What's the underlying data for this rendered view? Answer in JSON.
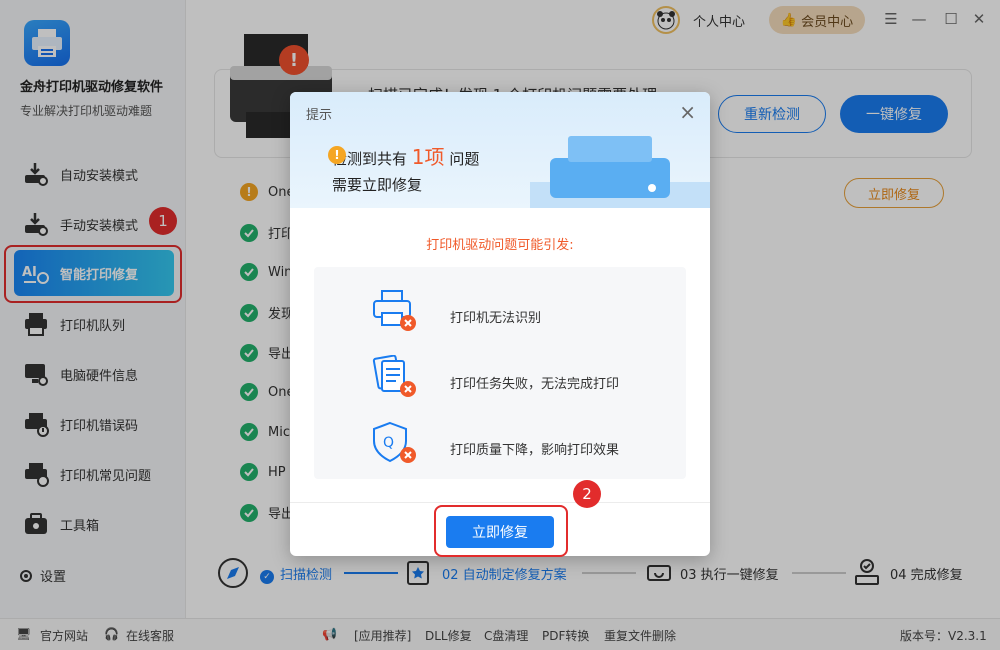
{
  "app": {
    "name": "金舟打印机驱动修复软件",
    "subtitle": "专业解决打印机驱动难题",
    "version": "版本号：V2.3.1"
  },
  "topbar": {
    "user_label": "个人中心",
    "vip_label": "会员中心"
  },
  "sidebar": {
    "items": [
      {
        "label": "自动安装模式",
        "icon": "download-gear-icon"
      },
      {
        "label": "手动安装模式",
        "icon": "download-hand-icon"
      },
      {
        "label": "智能打印修复",
        "icon": "ai-repair-icon",
        "active": true
      },
      {
        "label": "打印机队列",
        "icon": "printer-queue-icon"
      },
      {
        "label": "电脑硬件信息",
        "icon": "monitor-icon"
      },
      {
        "label": "打印机错误码",
        "icon": "error-code-icon"
      },
      {
        "label": "打印机常见问题",
        "icon": "faq-icon"
      },
      {
        "label": "工具箱",
        "icon": "toolbox-icon"
      }
    ],
    "settings_label": "设置"
  },
  "badges": {
    "one": "1",
    "two": "2"
  },
  "main": {
    "scan_text": "扫描已完成！发现 1 个打印机问题需要处理",
    "recheck_label": "重新检测",
    "onekey_label": "一键修复",
    "fix_now_label": "立即修复",
    "items": [
      {
        "label": "One",
        "status": "warn"
      },
      {
        "label": "打印",
        "status": "ok"
      },
      {
        "label": "Win",
        "status": "ok"
      },
      {
        "label": "发现",
        "status": "ok"
      },
      {
        "label": "导出",
        "status": "ok"
      },
      {
        "label": "One",
        "status": "ok"
      },
      {
        "label": "Mic",
        "status": "ok"
      },
      {
        "label": "HP",
        "status": "ok"
      },
      {
        "label": "导出",
        "status": "ok"
      }
    ]
  },
  "steps": [
    {
      "label": "扫描检测",
      "state": "done"
    },
    {
      "label": "02 自动制定修复方案",
      "state": "current"
    },
    {
      "label": "03 执行一键修复",
      "state": "pending"
    },
    {
      "label": "04 完成修复",
      "state": "pending"
    }
  ],
  "footer": {
    "website": "官方网站",
    "service": "在线客服",
    "recommend": "[应用推荐]",
    "links": [
      "DLL修复",
      "C盘清理",
      "PDF转换",
      "重复文件删除"
    ]
  },
  "modal": {
    "title": "提示",
    "msg_prefix": "检测到共有",
    "msg_count": "1项",
    "msg_suffix": "问题",
    "msg_line2": "需要立即修复",
    "subtitle": "打印机驱动问题可能引发:",
    "issues": [
      "打印机无法识别",
      "打印任务失败，无法完成打印",
      "打印质量下降，影响打印效果"
    ],
    "fix_label": "立即修复"
  },
  "colors": {
    "primary": "#1a7cf0",
    "accent_red": "#e22c2c",
    "warn_orange": "#f5a623",
    "ok_green": "#23b26d"
  }
}
